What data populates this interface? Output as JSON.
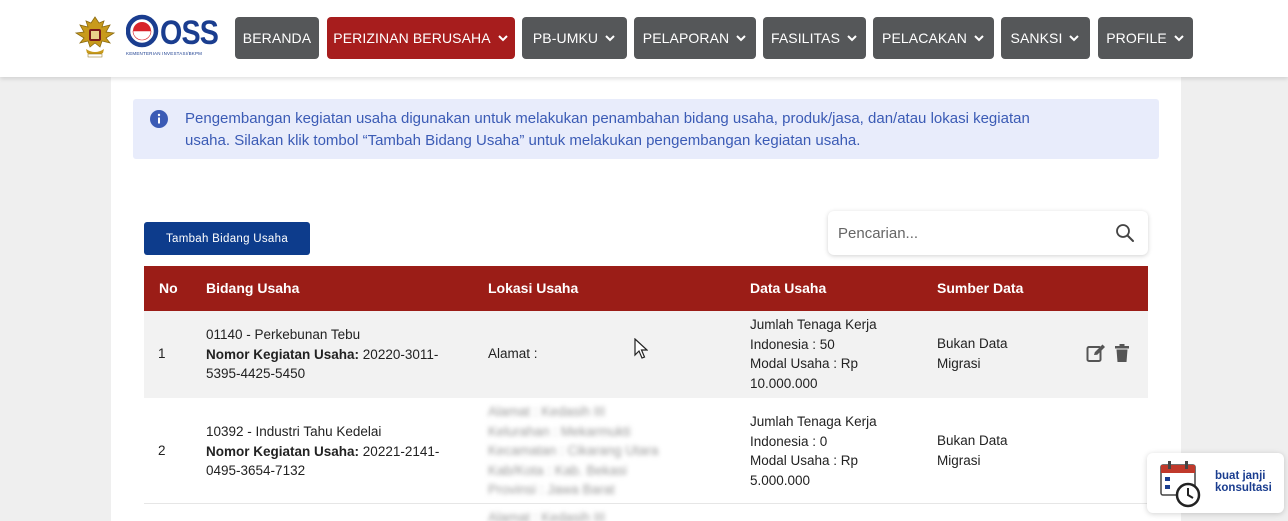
{
  "header": {
    "logo_text": "OSS",
    "logo_subtitle": "KEMENTERIAN INVESTASI/BKPM",
    "nav": [
      {
        "label": "BERANDA",
        "dropdown": false,
        "active": false
      },
      {
        "label": "PERIZINAN BERUSAHA",
        "dropdown": true,
        "active": true
      },
      {
        "label": "PB-UMKU",
        "dropdown": true,
        "active": false
      },
      {
        "label": "PELAPORAN",
        "dropdown": true,
        "active": false
      },
      {
        "label": "FASILITAS",
        "dropdown": true,
        "active": false
      },
      {
        "label": "PELACAKAN",
        "dropdown": true,
        "active": false
      },
      {
        "label": "SANKSI",
        "dropdown": true,
        "active": false
      },
      {
        "label": "PROFILE",
        "dropdown": true,
        "active": false
      }
    ]
  },
  "info": {
    "line1": "Pengembangan kegiatan usaha digunakan untuk melakukan penambahan bidang usaha, produk/jasa, dan/atau lokasi kegiatan",
    "line2": "usaha. Silakan klik tombol “Tambah Bidang Usaha” untuk melakukan pengembangan kegiatan usaha."
  },
  "toolbar": {
    "add_label": "Tambah Bidang Usaha",
    "search_placeholder": "Pencarian..."
  },
  "table": {
    "headers": [
      "No",
      "Bidang Usaha",
      "Lokasi Usaha",
      "Data Usaha",
      "Sumber Data"
    ],
    "rows": [
      {
        "no": "1",
        "bidang": "01140 - Perkebunan Tebu",
        "nomor_label": "Nomor Kegiatan Usaha:",
        "nomor_value_a": "20220-3011-",
        "nomor_value_b": "5395-4425-5450",
        "lokasi": [
          "Alamat :"
        ],
        "data": [
          "Jumlah Tenaga Kerja",
          "Indonesia : 50",
          "Modal Usaha : Rp",
          "10.000.000"
        ],
        "sumber": [
          "Bukan Data",
          "Migrasi"
        ]
      },
      {
        "no": "2",
        "bidang": "10392 - Industri Tahu Kedelai",
        "nomor_label": "Nomor Kegiatan Usaha:",
        "nomor_value_a": "20221-2141-",
        "nomor_value_b": "0495-3654-7132",
        "lokasi": [
          "Alamat : Kedasih III",
          "Kelurahan : Mekarmukti",
          "Kecamatan : Cikarang Utara",
          "Kab/Kota : Kab. Bekasi",
          "Provinsi : Jawa Barat"
        ],
        "data": [
          "Jumlah Tenaga Kerja",
          "Indonesia : 0",
          "Modal Usaha : Rp",
          "5.000.000"
        ],
        "sumber": [
          "Bukan Data",
          "Migrasi"
        ]
      },
      {
        "lokasi": [
          "Alamat : Kedasih III"
        ]
      }
    ]
  },
  "consult": {
    "line1": "buat janji",
    "line2": "konsultasi"
  },
  "colors": {
    "nav_bg": "#555759",
    "nav_active": "#a71d1d",
    "table_header": "#9b1d17",
    "primary_button": "#0d3c8c",
    "info_bg": "#e8ecfb",
    "info_text": "#3b5bb5"
  },
  "icons": [
    "garuda-emblem",
    "info-icon",
    "search-icon",
    "edit-icon",
    "trash-icon",
    "calendar-clock-icon",
    "chevron-down-icon"
  ]
}
